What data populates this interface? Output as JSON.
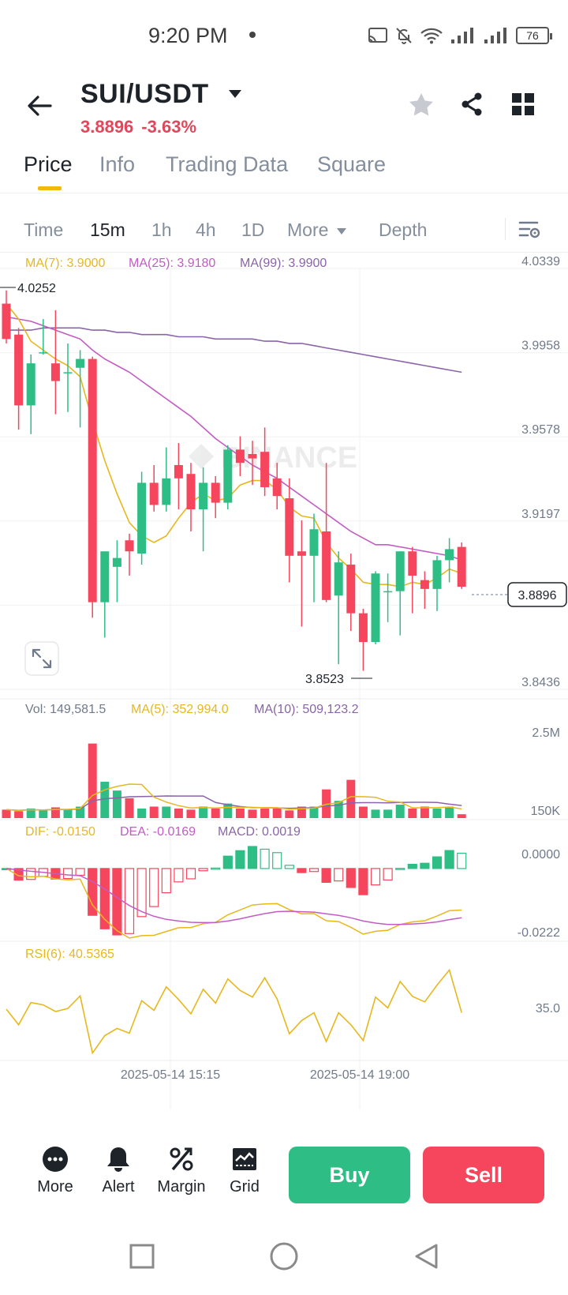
{
  "status_bar": {
    "time": "9:20 PM",
    "battery": "76"
  },
  "header": {
    "pair": "SUI/USDT",
    "last_price": "3.8896",
    "change_pct": "-3.63%"
  },
  "main_tabs": [
    "Price",
    "Info",
    "Trading Data",
    "Square"
  ],
  "intervals": [
    "Time",
    "15m",
    "1h",
    "4h",
    "1D",
    "More",
    "Depth"
  ],
  "active_interval": "15m",
  "indicators": {
    "ma7": "MA(7): 3.9000",
    "ma25": "MA(25): 3.9180",
    "ma99": "MA(99): 3.9900",
    "vol": "Vol: 149,581.5",
    "vol_ma5": "MA(5): 352,994.0",
    "vol_ma10": "MA(10): 509,123.2",
    "dif": "DIF: -0.0150",
    "dea": "DEA: -0.0169",
    "macd": "MACD: 0.0019",
    "rsi": "RSI(6): 40.5365"
  },
  "price_axis": [
    "4.0339",
    "3.9958",
    "3.9578",
    "3.9197",
    "3.8817",
    "3.8436"
  ],
  "current_price_tag": "3.8896",
  "high_label": "4.0252",
  "low_label": "3.8523",
  "volume_axis": [
    "2.5M",
    "150K"
  ],
  "macd_axis": [
    "0.0000",
    "-0.0222"
  ],
  "rsi_axis": [
    "35.0"
  ],
  "time_labels": [
    "2025-05-14 15:15",
    "2025-05-14 19:00"
  ],
  "watermark": "BINANCE",
  "bottom_tools": [
    "More",
    "Alert",
    "Margin",
    "Grid"
  ],
  "buy_label": "Buy",
  "sell_label": "Sell",
  "colors": {
    "up": "#2ebd85",
    "down": "#f6465d",
    "ma7": "#e6b81e",
    "ma25": "#c25cc4",
    "ma99": "#8a64a8"
  },
  "chart_data": {
    "type": "candlestick",
    "y_range": [
      3.8436,
      4.0339
    ],
    "candles": [
      {
        "o": 4.018,
        "h": 4.024,
        "l": 4.0,
        "c": 4.002
      },
      {
        "o": 4.004,
        "h": 4.007,
        "l": 3.961,
        "c": 3.972
      },
      {
        "o": 3.972,
        "h": 3.995,
        "l": 3.959,
        "c": 3.991
      },
      {
        "o": 3.996,
        "h": 4.011,
        "l": 3.995,
        "c": 3.996
      },
      {
        "o": 3.991,
        "h": 4.015,
        "l": 3.968,
        "c": 3.983
      },
      {
        "o": 3.987,
        "h": 4.0,
        "l": 3.969,
        "c": 3.987
      },
      {
        "o": 3.989,
        "h": 3.997,
        "l": 3.962,
        "c": 3.993
      },
      {
        "o": 3.993,
        "h": 3.994,
        "l": 3.876,
        "c": 3.883
      },
      {
        "o": 3.883,
        "h": 3.904,
        "l": 3.867,
        "c": 3.906
      },
      {
        "o": 3.899,
        "h": 3.911,
        "l": 3.883,
        "c": 3.903
      },
      {
        "o": 3.911,
        "h": 3.914,
        "l": 3.895,
        "c": 3.906
      },
      {
        "o": 3.905,
        "h": 3.942,
        "l": 3.9,
        "c": 3.937
      },
      {
        "o": 3.937,
        "h": 3.945,
        "l": 3.924,
        "c": 3.927
      },
      {
        "o": 3.927,
        "h": 3.953,
        "l": 3.924,
        "c": 3.939
      },
      {
        "o": 3.945,
        "h": 3.955,
        "l": 3.925,
        "c": 3.939
      },
      {
        "o": 3.941,
        "h": 3.946,
        "l": 3.915,
        "c": 3.925
      },
      {
        "o": 3.925,
        "h": 3.944,
        "l": 3.906,
        "c": 3.937
      },
      {
        "o": 3.937,
        "h": 3.94,
        "l": 3.921,
        "c": 3.928
      },
      {
        "o": 3.928,
        "h": 3.954,
        "l": 3.925,
        "c": 3.952
      },
      {
        "o": 3.952,
        "h": 3.958,
        "l": 3.94,
        "c": 3.946
      },
      {
        "o": 3.95,
        "h": 3.956,
        "l": 3.936,
        "c": 3.948
      },
      {
        "o": 3.951,
        "h": 3.962,
        "l": 3.931,
        "c": 3.935
      },
      {
        "o": 3.939,
        "h": 3.946,
        "l": 3.925,
        "c": 3.931
      },
      {
        "o": 3.93,
        "h": 3.939,
        "l": 3.892,
        "c": 3.904
      },
      {
        "o": 3.906,
        "h": 3.92,
        "l": 3.872,
        "c": 3.904
      },
      {
        "o": 3.904,
        "h": 3.923,
        "l": 3.883,
        "c": 3.916
      },
      {
        "o": 3.915,
        "h": 3.946,
        "l": 3.883,
        "c": 3.884
      },
      {
        "o": 3.886,
        "h": 3.906,
        "l": 3.855,
        "c": 3.901
      },
      {
        "o": 3.9,
        "h": 3.905,
        "l": 3.87,
        "c": 3.878
      },
      {
        "o": 3.878,
        "h": 3.88,
        "l": 3.852,
        "c": 3.865
      },
      {
        "o": 3.865,
        "h": 3.897,
        "l": 3.864,
        "c": 3.896
      },
      {
        "o": 3.888,
        "h": 3.896,
        "l": 3.874,
        "c": 3.888
      },
      {
        "o": 3.888,
        "h": 3.906,
        "l": 3.868,
        "c": 3.906
      },
      {
        "o": 3.906,
        "h": 3.908,
        "l": 3.878,
        "c": 3.895
      },
      {
        "o": 3.893,
        "h": 3.897,
        "l": 3.88,
        "c": 3.889
      },
      {
        "o": 3.889,
        "h": 3.904,
        "l": 3.879,
        "c": 3.902
      },
      {
        "o": 3.902,
        "h": 3.912,
        "l": 3.892,
        "c": 3.907
      },
      {
        "o": 3.908,
        "h": 3.91,
        "l": 3.889,
        "c": 3.89
      }
    ],
    "ma7": [
      4.018,
      4.011,
      4.001,
      3.997,
      3.993,
      3.99,
      3.985,
      3.965,
      3.947,
      3.932,
      3.919,
      3.913,
      3.91,
      3.913,
      3.921,
      3.928,
      3.932,
      3.929,
      3.93,
      3.936,
      3.938,
      3.938,
      3.934,
      3.926,
      3.922,
      3.921,
      3.91,
      3.903,
      3.898,
      3.892,
      3.891,
      3.891,
      3.89,
      3.892,
      3.891,
      3.894,
      3.898,
      3.896
    ],
    "ma25": [
      4.012,
      4.011,
      4.01,
      4.008,
      4.006,
      4.004,
      4.002,
      3.997,
      3.993,
      3.99,
      3.987,
      3.983,
      3.979,
      3.975,
      3.971,
      3.967,
      3.962,
      3.957,
      3.953,
      3.949,
      3.945,
      3.942,
      3.939,
      3.935,
      3.931,
      3.927,
      3.923,
      3.919,
      3.915,
      3.912,
      3.909,
      3.909,
      3.908,
      3.907,
      3.906,
      3.905,
      3.904,
      3.902
    ],
    "ma99": [
      4.006,
      4.006,
      4.006,
      4.007,
      4.007,
      4.007,
      4.007,
      4.006,
      4.006,
      4.005,
      4.005,
      4.004,
      4.004,
      4.004,
      4.003,
      4.003,
      4.003,
      4.002,
      4.002,
      4.002,
      4.002,
      4.001,
      4.001,
      4.0,
      4.0,
      3.999,
      3.998,
      3.997,
      3.996,
      3.995,
      3.994,
      3.993,
      3.992,
      3.991,
      3.99,
      3.989,
      3.988,
      3.987
    ],
    "volume": [
      0.22,
      0.18,
      0.25,
      0.2,
      0.28,
      0.22,
      0.3,
      1.95,
      0.95,
      0.72,
      0.52,
      0.25,
      0.3,
      0.3,
      0.25,
      0.22,
      0.3,
      0.25,
      0.38,
      0.25,
      0.22,
      0.25,
      0.25,
      0.2,
      0.3,
      0.3,
      0.75,
      0.45,
      1.0,
      0.3,
      0.22,
      0.22,
      0.35,
      0.25,
      0.3,
      0.25,
      0.3,
      0.1
    ],
    "volume_max": 2.5,
    "rsi": [
      36.4,
      33.8,
      37.5,
      37.1,
      36.0,
      36.5,
      38.6,
      29.1,
      32.0,
      33.2,
      32.4,
      37.8,
      36.2,
      40.1,
      38.0,
      35.6,
      39.7,
      37.4,
      41.4,
      39.5,
      38.4,
      41.6,
      38.1,
      32.3,
      34.5,
      35.8,
      31.0,
      35.8,
      33.8,
      31.2,
      38.4,
      36.6,
      41.0,
      38.5,
      37.6,
      40.4,
      42.9,
      35.8
    ]
  }
}
